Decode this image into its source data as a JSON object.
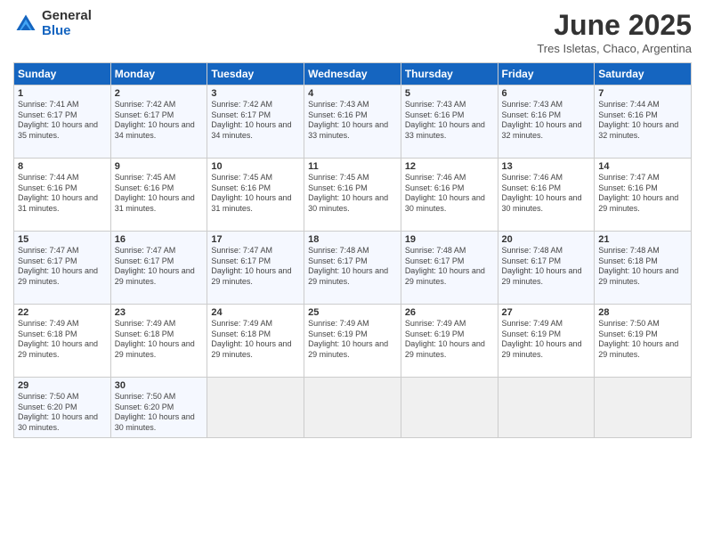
{
  "logo": {
    "general": "General",
    "blue": "Blue"
  },
  "title": "June 2025",
  "location": "Tres Isletas, Chaco, Argentina",
  "headers": [
    "Sunday",
    "Monday",
    "Tuesday",
    "Wednesday",
    "Thursday",
    "Friday",
    "Saturday"
  ],
  "weeks": [
    [
      {
        "day": "1",
        "sunrise": "Sunrise: 7:41 AM",
        "sunset": "Sunset: 6:17 PM",
        "daylight": "Daylight: 10 hours and 35 minutes."
      },
      {
        "day": "2",
        "sunrise": "Sunrise: 7:42 AM",
        "sunset": "Sunset: 6:17 PM",
        "daylight": "Daylight: 10 hours and 34 minutes."
      },
      {
        "day": "3",
        "sunrise": "Sunrise: 7:42 AM",
        "sunset": "Sunset: 6:17 PM",
        "daylight": "Daylight: 10 hours and 34 minutes."
      },
      {
        "day": "4",
        "sunrise": "Sunrise: 7:43 AM",
        "sunset": "Sunset: 6:16 PM",
        "daylight": "Daylight: 10 hours and 33 minutes."
      },
      {
        "day": "5",
        "sunrise": "Sunrise: 7:43 AM",
        "sunset": "Sunset: 6:16 PM",
        "daylight": "Daylight: 10 hours and 33 minutes."
      },
      {
        "day": "6",
        "sunrise": "Sunrise: 7:43 AM",
        "sunset": "Sunset: 6:16 PM",
        "daylight": "Daylight: 10 hours and 32 minutes."
      },
      {
        "day": "7",
        "sunrise": "Sunrise: 7:44 AM",
        "sunset": "Sunset: 6:16 PM",
        "daylight": "Daylight: 10 hours and 32 minutes."
      }
    ],
    [
      {
        "day": "8",
        "sunrise": "Sunrise: 7:44 AM",
        "sunset": "Sunset: 6:16 PM",
        "daylight": "Daylight: 10 hours and 31 minutes."
      },
      {
        "day": "9",
        "sunrise": "Sunrise: 7:45 AM",
        "sunset": "Sunset: 6:16 PM",
        "daylight": "Daylight: 10 hours and 31 minutes."
      },
      {
        "day": "10",
        "sunrise": "Sunrise: 7:45 AM",
        "sunset": "Sunset: 6:16 PM",
        "daylight": "Daylight: 10 hours and 31 minutes."
      },
      {
        "day": "11",
        "sunrise": "Sunrise: 7:45 AM",
        "sunset": "Sunset: 6:16 PM",
        "daylight": "Daylight: 10 hours and 30 minutes."
      },
      {
        "day": "12",
        "sunrise": "Sunrise: 7:46 AM",
        "sunset": "Sunset: 6:16 PM",
        "daylight": "Daylight: 10 hours and 30 minutes."
      },
      {
        "day": "13",
        "sunrise": "Sunrise: 7:46 AM",
        "sunset": "Sunset: 6:16 PM",
        "daylight": "Daylight: 10 hours and 30 minutes."
      },
      {
        "day": "14",
        "sunrise": "Sunrise: 7:47 AM",
        "sunset": "Sunset: 6:16 PM",
        "daylight": "Daylight: 10 hours and 29 minutes."
      }
    ],
    [
      {
        "day": "15",
        "sunrise": "Sunrise: 7:47 AM",
        "sunset": "Sunset: 6:17 PM",
        "daylight": "Daylight: 10 hours and 29 minutes."
      },
      {
        "day": "16",
        "sunrise": "Sunrise: 7:47 AM",
        "sunset": "Sunset: 6:17 PM",
        "daylight": "Daylight: 10 hours and 29 minutes."
      },
      {
        "day": "17",
        "sunrise": "Sunrise: 7:47 AM",
        "sunset": "Sunset: 6:17 PM",
        "daylight": "Daylight: 10 hours and 29 minutes."
      },
      {
        "day": "18",
        "sunrise": "Sunrise: 7:48 AM",
        "sunset": "Sunset: 6:17 PM",
        "daylight": "Daylight: 10 hours and 29 minutes."
      },
      {
        "day": "19",
        "sunrise": "Sunrise: 7:48 AM",
        "sunset": "Sunset: 6:17 PM",
        "daylight": "Daylight: 10 hours and 29 minutes."
      },
      {
        "day": "20",
        "sunrise": "Sunrise: 7:48 AM",
        "sunset": "Sunset: 6:17 PM",
        "daylight": "Daylight: 10 hours and 29 minutes."
      },
      {
        "day": "21",
        "sunrise": "Sunrise: 7:48 AM",
        "sunset": "Sunset: 6:18 PM",
        "daylight": "Daylight: 10 hours and 29 minutes."
      }
    ],
    [
      {
        "day": "22",
        "sunrise": "Sunrise: 7:49 AM",
        "sunset": "Sunset: 6:18 PM",
        "daylight": "Daylight: 10 hours and 29 minutes."
      },
      {
        "day": "23",
        "sunrise": "Sunrise: 7:49 AM",
        "sunset": "Sunset: 6:18 PM",
        "daylight": "Daylight: 10 hours and 29 minutes."
      },
      {
        "day": "24",
        "sunrise": "Sunrise: 7:49 AM",
        "sunset": "Sunset: 6:18 PM",
        "daylight": "Daylight: 10 hours and 29 minutes."
      },
      {
        "day": "25",
        "sunrise": "Sunrise: 7:49 AM",
        "sunset": "Sunset: 6:19 PM",
        "daylight": "Daylight: 10 hours and 29 minutes."
      },
      {
        "day": "26",
        "sunrise": "Sunrise: 7:49 AM",
        "sunset": "Sunset: 6:19 PM",
        "daylight": "Daylight: 10 hours and 29 minutes."
      },
      {
        "day": "27",
        "sunrise": "Sunrise: 7:49 AM",
        "sunset": "Sunset: 6:19 PM",
        "daylight": "Daylight: 10 hours and 29 minutes."
      },
      {
        "day": "28",
        "sunrise": "Sunrise: 7:50 AM",
        "sunset": "Sunset: 6:19 PM",
        "daylight": "Daylight: 10 hours and 29 minutes."
      }
    ],
    [
      {
        "day": "29",
        "sunrise": "Sunrise: 7:50 AM",
        "sunset": "Sunset: 6:20 PM",
        "daylight": "Daylight: 10 hours and 30 minutes."
      },
      {
        "day": "30",
        "sunrise": "Sunrise: 7:50 AM",
        "sunset": "Sunset: 6:20 PM",
        "daylight": "Daylight: 10 hours and 30 minutes."
      },
      {
        "day": "",
        "sunrise": "",
        "sunset": "",
        "daylight": ""
      },
      {
        "day": "",
        "sunrise": "",
        "sunset": "",
        "daylight": ""
      },
      {
        "day": "",
        "sunrise": "",
        "sunset": "",
        "daylight": ""
      },
      {
        "day": "",
        "sunrise": "",
        "sunset": "",
        "daylight": ""
      },
      {
        "day": "",
        "sunrise": "",
        "sunset": "",
        "daylight": ""
      }
    ]
  ]
}
